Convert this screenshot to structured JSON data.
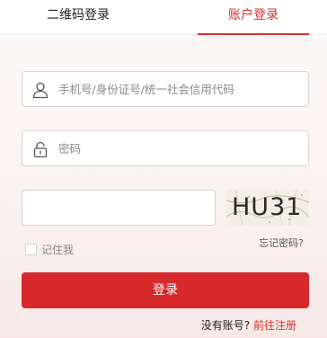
{
  "tabs": {
    "qr_label": "二维码登录",
    "account_label": "账户登录",
    "active": "account"
  },
  "form": {
    "username_placeholder": "手机号/身份证号/统一社会信用代码",
    "password_placeholder": "密码",
    "captcha_value": "",
    "captcha_image_text": "HU31",
    "remember_label": "记住我",
    "remember_checked": false,
    "forgot_label": "忘记密码?",
    "login_label": "登录",
    "no_account_text": "没有账号?",
    "register_label": "前往注册"
  },
  "colors": {
    "accent": "#d7292c",
    "border": "#d9d3d3"
  },
  "icons": {
    "username": "user-icon",
    "password": "lock-icon"
  }
}
